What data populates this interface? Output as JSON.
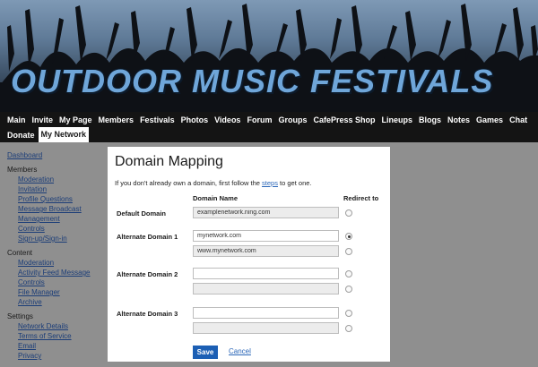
{
  "banner": {
    "title": "OUTDOOR MUSIC FESTIVALS"
  },
  "nav": {
    "row1": [
      "Main",
      "Invite",
      "My Page",
      "Members",
      "Festivals",
      "Photos",
      "Videos",
      "Forum",
      "Groups",
      "CafePress Shop",
      "Lineups",
      "Blogs",
      "Notes",
      "Games",
      "Chat"
    ],
    "row2": [
      "Donate",
      "My Network"
    ],
    "active": "My Network"
  },
  "sidebar": {
    "dashboard": "Dashboard",
    "members_head": "Members",
    "members_items": [
      "Moderation",
      "Invitation",
      "Profile Questions",
      "Message Broadcast",
      "Management",
      "Controls",
      "Sign-up/Sign-in"
    ],
    "content_head": "Content",
    "content_items": [
      "Moderation",
      "Activity Feed Message",
      "Controls",
      "File Manager",
      "Archive"
    ],
    "settings_head": "Settings",
    "settings_items": [
      "Network Details",
      "Terms of Service",
      "Email",
      "Privacy"
    ]
  },
  "dialog": {
    "title": "Domain Mapping",
    "intro_before": "If you don't already own a domain, first follow the ",
    "intro_link": "steps",
    "intro_after": " to get one.",
    "col_domain": "Domain Name",
    "col_redirect": "Redirect to",
    "default_label": "Default Domain",
    "default_value": "examplenetwork.ning.com",
    "alt1_label": "Alternate Domain 1",
    "alt1_value": "mynetwork.com",
    "alt1_www": "www.mynetwork.com",
    "alt2_label": "Alternate Domain 2",
    "alt2_value": "",
    "alt2_www": "",
    "alt3_label": "Alternate Domain 3",
    "alt3_value": "",
    "alt3_www": "",
    "save_label": "Save",
    "cancel_label": "Cancel"
  }
}
